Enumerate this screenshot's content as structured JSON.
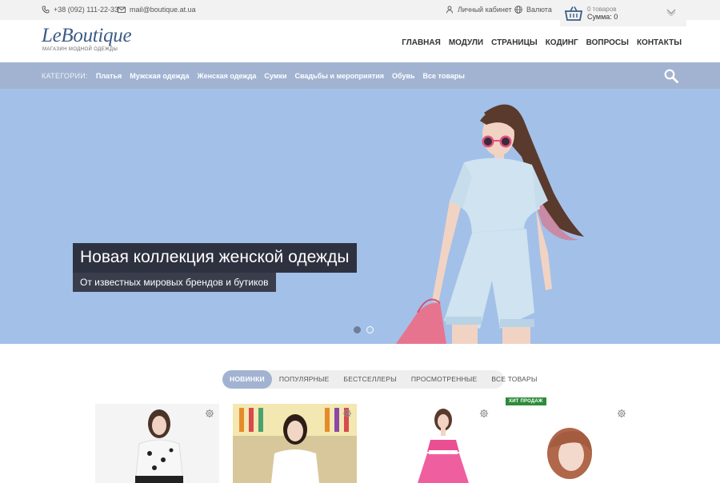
{
  "topbar": {
    "phone": "+38 (092) 111-22-33",
    "email": "mail@boutique.at.ua",
    "account": "Личный кабинет",
    "currency": "Валюта"
  },
  "cart": {
    "count": "0 товаров",
    "sum": "Сумма: 0"
  },
  "logo": {
    "brand": "LeBoutique",
    "tagline": "МАГАЗИН МОДНОЙ ОДЕЖДЫ"
  },
  "mainnav": [
    "ГЛАВНАЯ",
    "МОДУЛИ",
    "СТРАНИЦЫ",
    "КОДИНГ",
    "ВОПРОСЫ",
    "КОНТАКТЫ"
  ],
  "categories": {
    "label": "КАТЕГОРИИ:",
    "items": [
      "Платья",
      "Мужская одежда",
      "Женская одежда",
      "Сумки",
      "Свадьбы и мероприятия",
      "Обувь",
      "Все товары"
    ]
  },
  "hero": {
    "title": "Новая коллекция женской одежды",
    "subtitle": "От известных мировых брендов и бутиков",
    "slides": 2,
    "active_slide": 1
  },
  "tabs": {
    "items": [
      "НОВИНКИ",
      "ПОПУЛЯРНЫЕ",
      "БЕСТСЕЛЛЕРЫ",
      "ПРОСМОТРЕННЫЕ",
      "ВСЕ ТОВАРЫ"
    ],
    "active": 0
  },
  "products": {
    "badge": "ХИТ ПРОДАЖ"
  },
  "colors": {
    "accent": "#a2b3d1",
    "hero_bg": "#a3c0e8",
    "brand": "#3b5b87",
    "badge": "#2e8b3b"
  }
}
